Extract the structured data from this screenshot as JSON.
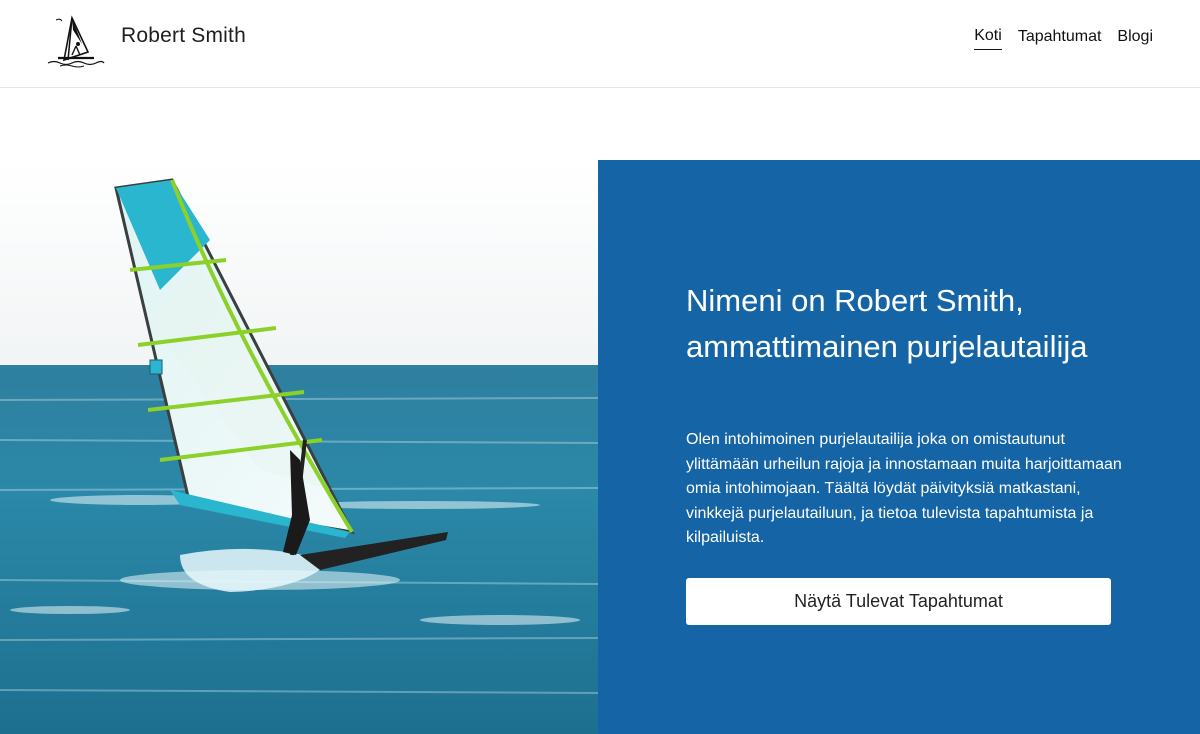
{
  "header": {
    "logo_icon": "windsurfer-logo-icon",
    "site_name": "Robert Smith",
    "nav": [
      {
        "label": "Koti",
        "active": true
      },
      {
        "label": "Tapahtumat",
        "active": false
      },
      {
        "label": "Blogi",
        "active": false
      }
    ]
  },
  "hero": {
    "image_icon": "windsurfer-photo",
    "title": "Nimeni on Robert Smith, ammattimainen purjelautailija",
    "text": "Olen intohimoinen purjelautailija joka on omistautunut ylittämään urheilun rajoja ja innostamaan muita harjoittamaan omia intohimojaan. Täältä löydät päivityksiä matkastani, vinkkejä purjelautailuun, ja tietoa tulevista tapahtumista ja kilpailuista.",
    "button_label": "Näytä Tulevat Tapahtumat",
    "panel_color": "#1565a6"
  }
}
